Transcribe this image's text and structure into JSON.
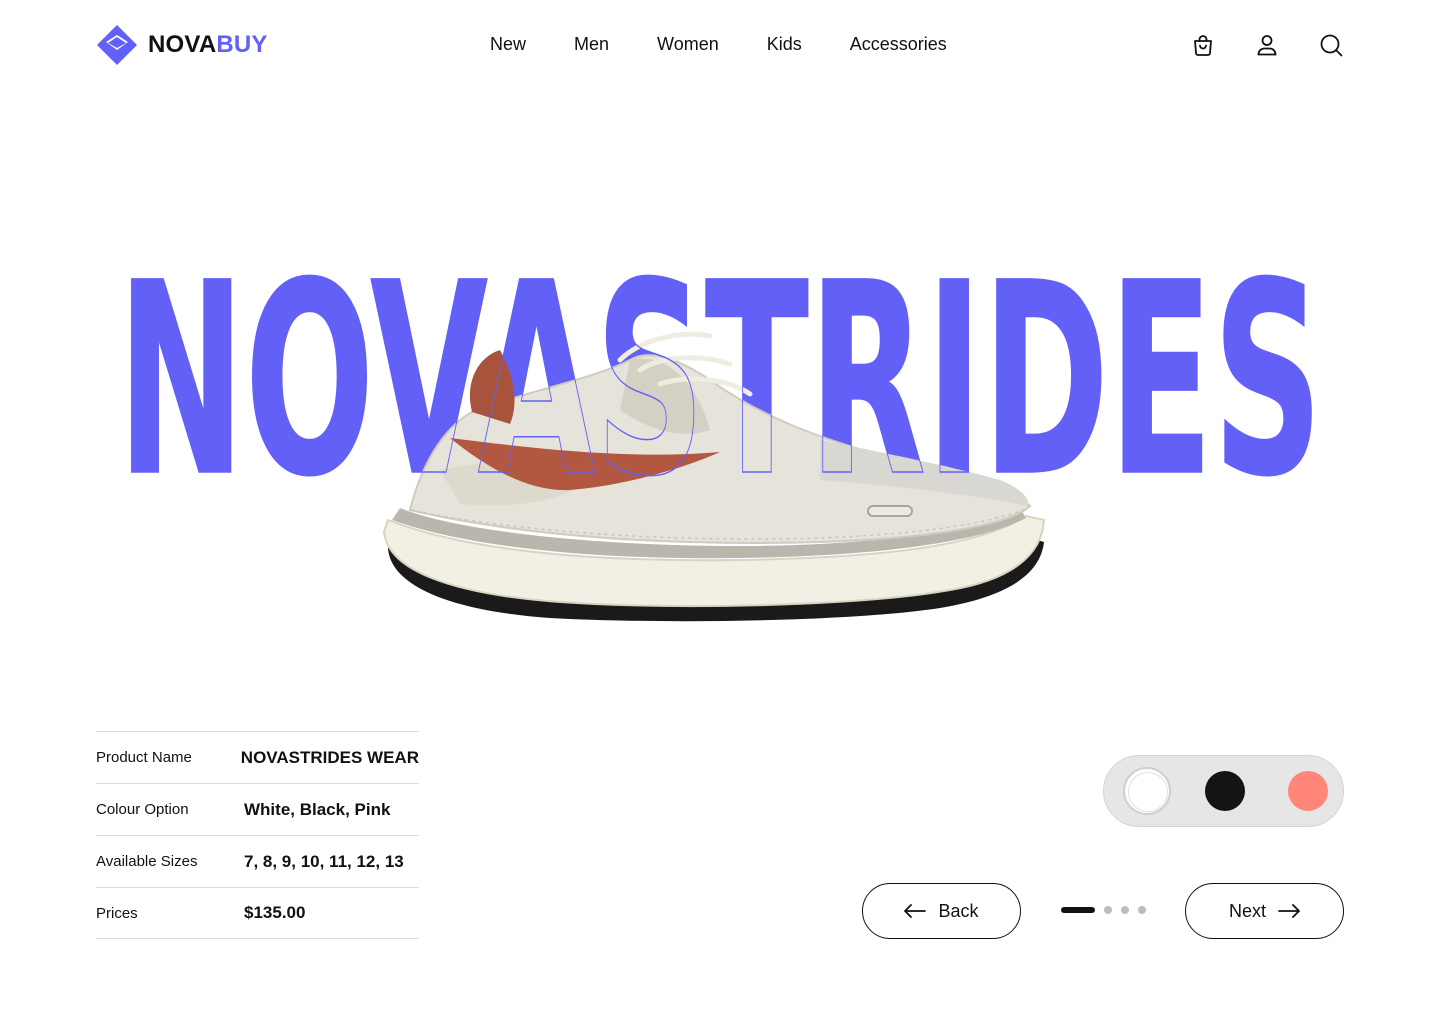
{
  "brand": {
    "name_part1": "NOVA",
    "name_part2": "BUY",
    "accent": "#6260F7"
  },
  "nav": {
    "items": [
      "New",
      "Men",
      "Women",
      "Kids",
      "Accessories"
    ]
  },
  "header_icons": [
    "shopping-bag-icon",
    "user-icon",
    "search-icon"
  ],
  "hero": {
    "title": "NOVASTRIDES"
  },
  "details": [
    {
      "label": "Product Name",
      "value": "NOVASTRIDES WEAR"
    },
    {
      "label": "Colour Option",
      "value": "White, Black, Pink"
    },
    {
      "label": "Available Sizes",
      "value": "7, 8, 9, 10, 11, 12, 13"
    },
    {
      "label": "Prices",
      "value": "$135.00"
    }
  ],
  "colors": {
    "options": [
      {
        "name": "White",
        "hex": "#FFFFFF",
        "selected": true
      },
      {
        "name": "Black",
        "hex": "#141414",
        "selected": false
      },
      {
        "name": "Pink",
        "hex": "#FF8678",
        "selected": false
      }
    ]
  },
  "pagination": {
    "back_label": "Back",
    "next_label": "Next",
    "current": 1,
    "total": 4
  }
}
